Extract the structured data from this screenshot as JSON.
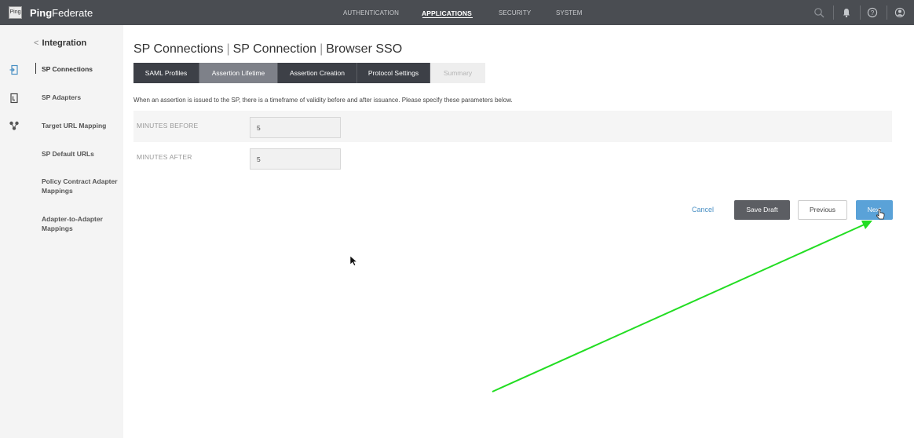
{
  "brand": {
    "logo_text": "Ping",
    "name_bold": "Ping",
    "name_rest": "Federate"
  },
  "topnav": {
    "items": [
      "AUTHENTICATION",
      "APPLICATIONS",
      "SECURITY",
      "SYSTEM"
    ],
    "active": "APPLICATIONS"
  },
  "top_icons": [
    "search-icon",
    "notification-bell-icon",
    "help-icon",
    "user-profile-icon"
  ],
  "sidebar": {
    "back_label": "Integration",
    "rail_icons": [
      "sp-connections-icon",
      "sp-adapters-icon",
      "target-url-mapping-icon"
    ],
    "items": [
      {
        "label": "SP Connections",
        "active": true
      },
      {
        "label": "SP Adapters",
        "active": false
      },
      {
        "label": "Target URL Mapping",
        "active": false
      },
      {
        "label": "SP Default URLs",
        "active": false
      },
      {
        "label": "Policy Contract Adapter Mappings",
        "active": false
      },
      {
        "label": "Adapter-to-Adapter Mappings",
        "active": false
      }
    ]
  },
  "breadcrumb": [
    "SP Connections",
    "SP Connection",
    "Browser SSO"
  ],
  "tabs": [
    {
      "label": "SAML Profiles",
      "state": "default"
    },
    {
      "label": "Assertion Lifetime",
      "state": "selected"
    },
    {
      "label": "Assertion Creation",
      "state": "default"
    },
    {
      "label": "Protocol Settings",
      "state": "default"
    },
    {
      "label": "Summary",
      "state": "disabled"
    }
  ],
  "description": "When an assertion is issued to the SP, there is a timeframe of validity before and after issuance. Please specify these parameters below.",
  "fields": [
    {
      "label": "MINUTES BEFORE",
      "value": "5"
    },
    {
      "label": "MINUTES AFTER",
      "value": "5"
    }
  ],
  "actions": {
    "cancel": "Cancel",
    "save_draft": "Save Draft",
    "previous": "Previous",
    "next": "Next"
  },
  "colors": {
    "topbar": "#4a4d52",
    "tab_dark": "#3d4047",
    "tab_selected": "#7e8189",
    "primary_button": "#5aa2d8",
    "link": "#4a90c4",
    "annotation_arrow": "#22dd22"
  }
}
